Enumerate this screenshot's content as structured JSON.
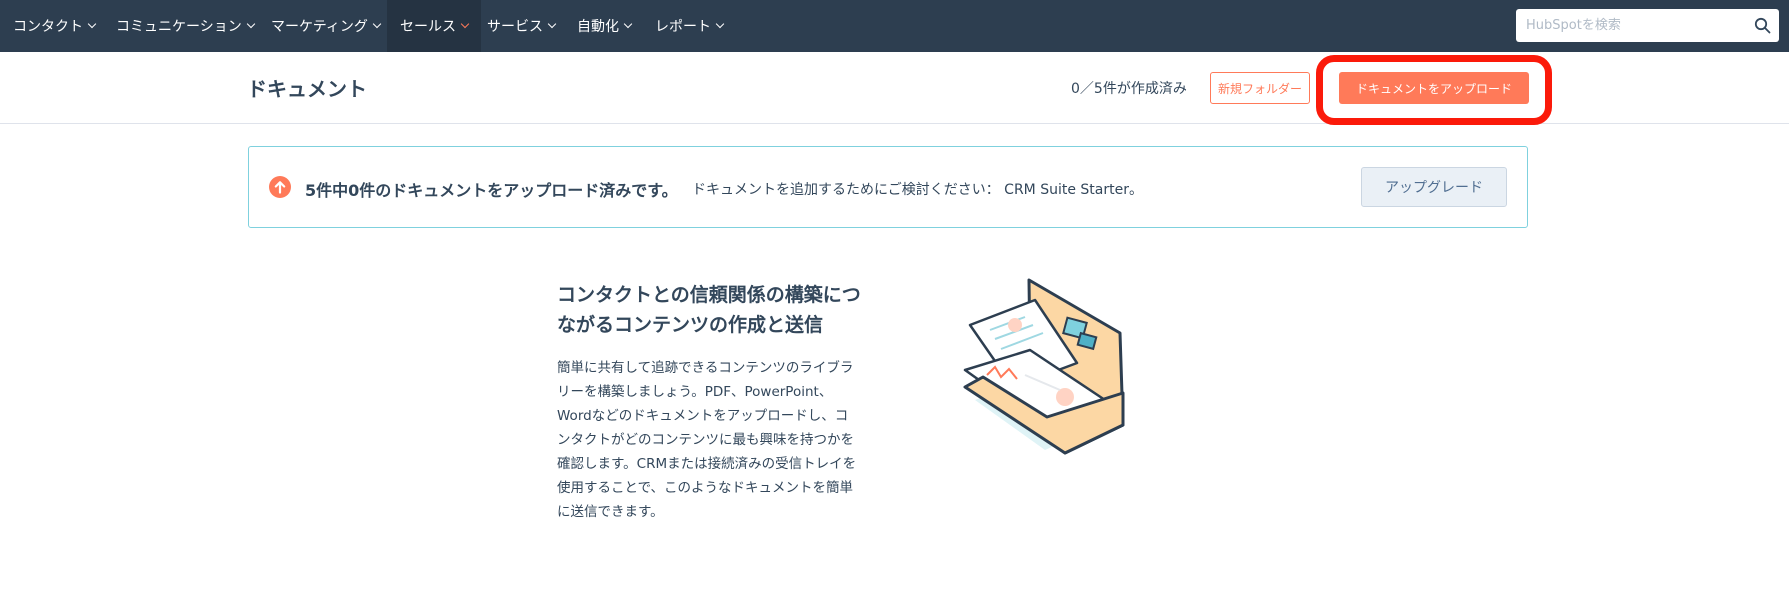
{
  "nav": {
    "items": [
      {
        "label": "コンタクト"
      },
      {
        "label": "コミュニケーション"
      },
      {
        "label": "マーケティング"
      },
      {
        "label": "セールス",
        "active": true
      },
      {
        "label": "サービス"
      },
      {
        "label": "自動化"
      },
      {
        "label": "レポート"
      }
    ],
    "search_placeholder": "HubSpotを検索"
  },
  "header": {
    "title": "ドキュメント",
    "count_text": "0／5件が作成済み",
    "new_folder_label": "新規フォルダー",
    "upload_label": "ドキュメントをアップロード"
  },
  "banner": {
    "title": "5件中0件のドキュメントをアップロード済みです。",
    "description": "ドキュメントを追加するためにご検討ください： CRM Suite Starter。",
    "upgrade_label": "アップグレード"
  },
  "promo": {
    "heading": "コンタクトとの信頼関係の構築につながるコンテンツの作成と送信",
    "body": "簡単に共有して追跡できるコンテンツのライブラリーを構築しましょう。PDF、PowerPoint、Wordなどのドキュメントをアップロードし、コンタクトがどのコンテンツに最も興味を持つかを確認します。CRMまたは接続済みの受信トレイを使用することで、このようなドキュメントを簡単に送信できます。"
  },
  "colors": {
    "nav_bg": "#2d3e50",
    "accent": "#ff7a59",
    "highlight": "#fb1a0a",
    "banner_border": "#7fd1de"
  },
  "icons": {
    "search": "search-icon",
    "upload_arrow": "upload-arrow-icon",
    "chevron": "chevron-down-icon"
  }
}
